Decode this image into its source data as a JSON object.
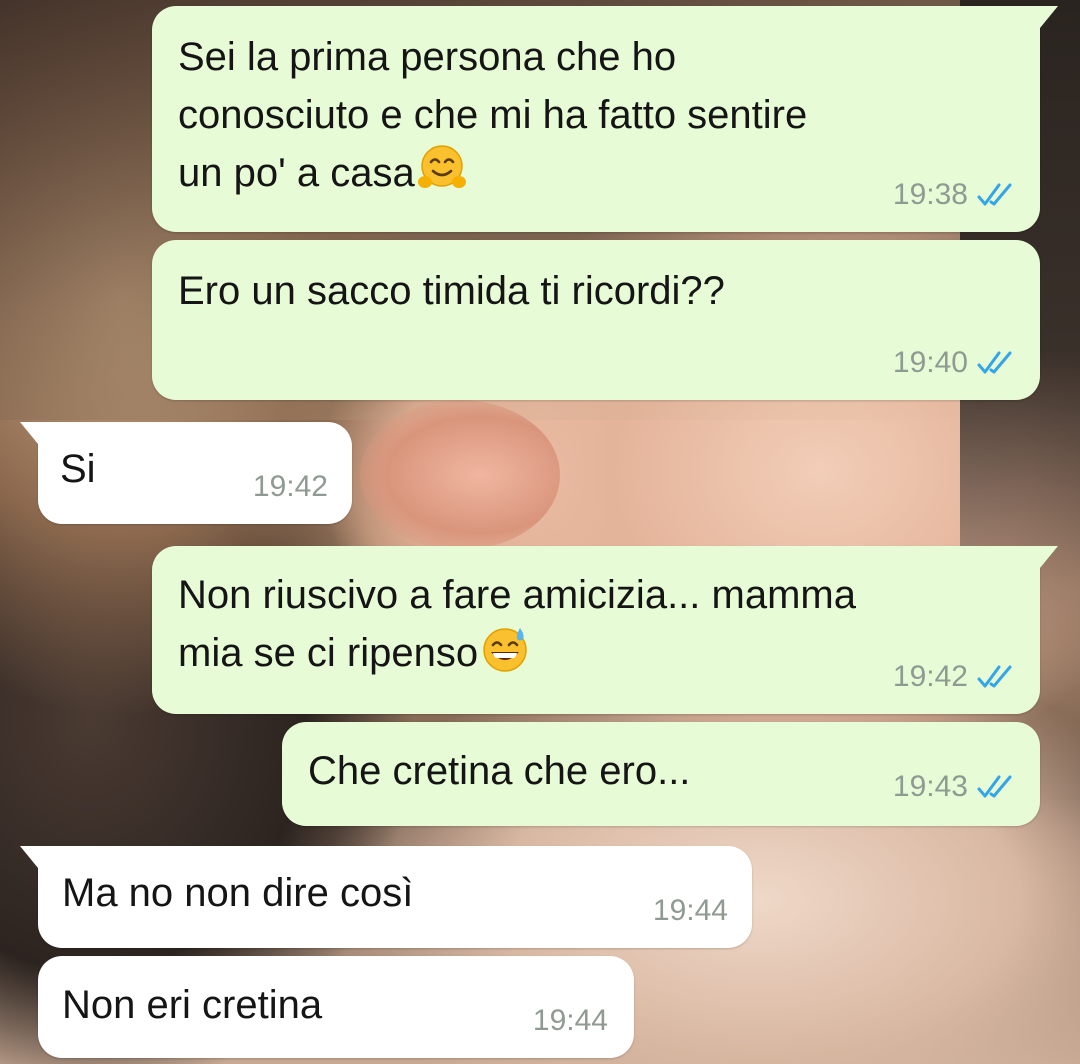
{
  "theme": {
    "outgoing_bubble": "#e7fcd6",
    "incoming_bubble": "#ffffff",
    "read_ticks": "#34a5e8",
    "time_color": "#8f9a92"
  },
  "messages": [
    {
      "direction": "outgoing",
      "lines": [
        "Sei la prima persona che ho",
        "conosciuto e che mi ha fatto sentire",
        "un po' a casa"
      ],
      "emoji": "hugging-face-icon",
      "time": "19:38",
      "status": "read"
    },
    {
      "direction": "outgoing",
      "lines": [
        "Ero un sacco timida ti ricordi??"
      ],
      "time": "19:40",
      "status": "read"
    },
    {
      "direction": "incoming",
      "lines": [
        "Si"
      ],
      "time": "19:42"
    },
    {
      "direction": "outgoing",
      "lines": [
        "Non riuscivo a fare amicizia... mamma",
        "mia se ci ripenso"
      ],
      "emoji": "grinning-sweat-icon",
      "time": "19:42",
      "status": "read"
    },
    {
      "direction": "outgoing",
      "lines": [
        "Che cretina che ero..."
      ],
      "time": "19:43",
      "status": "read"
    },
    {
      "direction": "incoming",
      "lines": [
        "Ma no non dire così"
      ],
      "time": "19:44"
    },
    {
      "direction": "incoming",
      "lines": [
        "Non eri cretina"
      ],
      "time": "19:44"
    }
  ]
}
